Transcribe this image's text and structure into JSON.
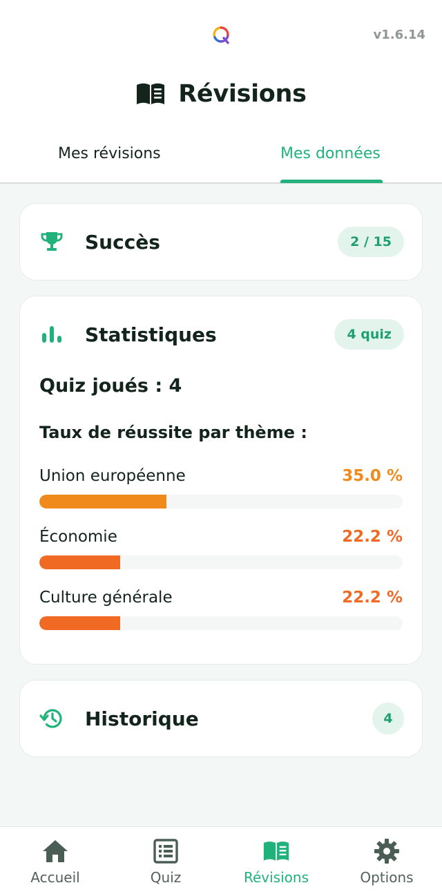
{
  "app": {
    "version": "v1.6.14"
  },
  "header": {
    "title": "Révisions"
  },
  "tabs": [
    {
      "label": "Mes révisions",
      "active": false
    },
    {
      "label": "Mes données",
      "active": true
    }
  ],
  "achievements": {
    "title": "Succès",
    "badge": "2 / 15"
  },
  "statistics": {
    "title": "Statistiques",
    "badge": "4 quiz",
    "quiz_played": "Quiz joués : 4",
    "rate_title": "Taux de réussite par thème :",
    "themes": [
      {
        "name": "Union européenne",
        "percent_label": "35.0 %",
        "value": 35.0,
        "color": "#f08a1c"
      },
      {
        "name": "Économie",
        "percent_label": "22.2 %",
        "value": 22.2,
        "color": "#f06a24"
      },
      {
        "name": "Culture générale",
        "percent_label": "22.2 %",
        "value": 22.2,
        "color": "#f06a24"
      }
    ]
  },
  "history": {
    "title": "Historique",
    "badge": "4"
  },
  "nav": [
    {
      "label": "Accueil",
      "icon": "home-icon",
      "active": false
    },
    {
      "label": "Quiz",
      "icon": "list-icon",
      "active": false
    },
    {
      "label": "Révisions",
      "icon": "book-icon",
      "active": true
    },
    {
      "label": "Options",
      "icon": "gear-icon",
      "active": false
    }
  ],
  "colors": {
    "accent": "#21b27c",
    "text": "#13241d",
    "background": "#f3f7f5"
  }
}
